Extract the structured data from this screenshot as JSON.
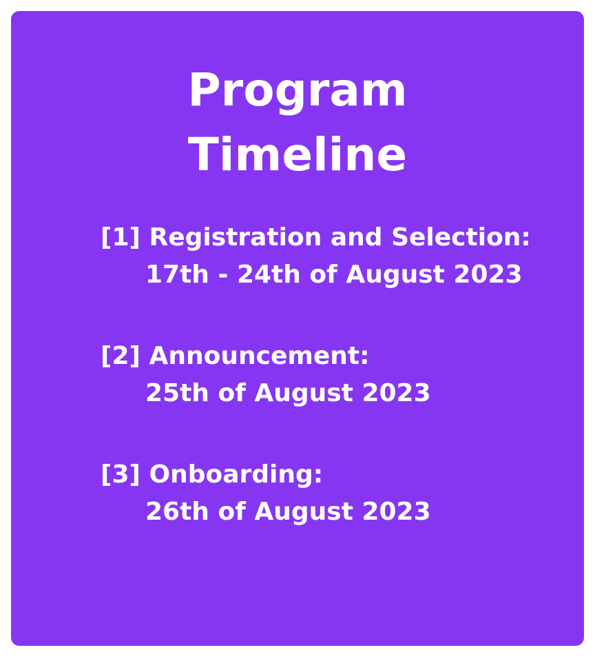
{
  "card": {
    "title_line1": "Program",
    "title_line2": "Timeline",
    "background_color": "#8636f2"
  },
  "timeline": [
    {
      "label": "[1] Registration and Selection:",
      "date": "17th - 24th of August 2023"
    },
    {
      "label": "[2] Announcement:",
      "date": "25th of August 2023"
    },
    {
      "label": "[3] Onboarding:",
      "date": "26th of August 2023"
    }
  ]
}
